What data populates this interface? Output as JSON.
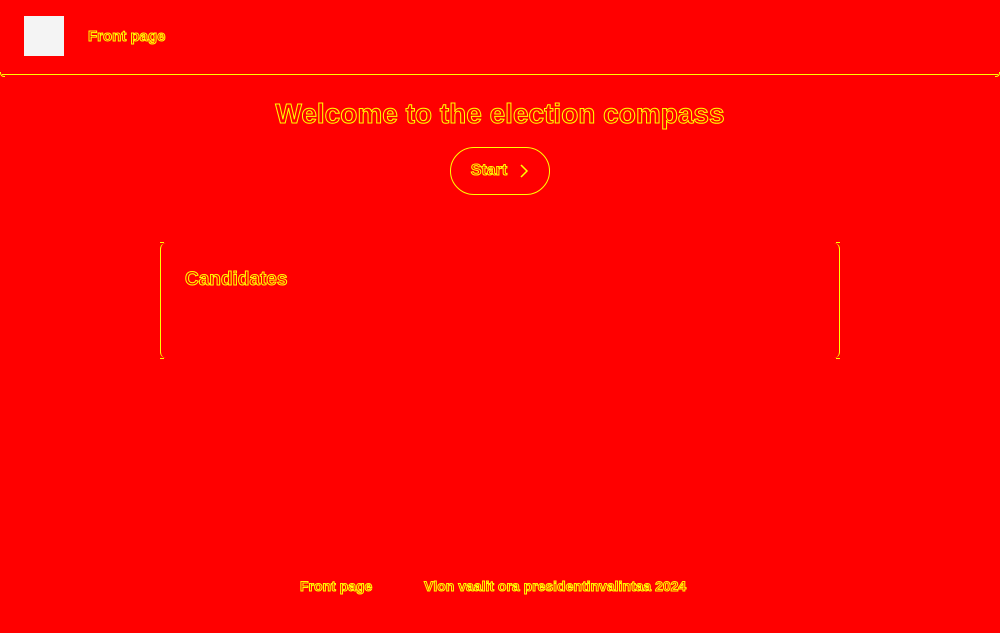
{
  "header": {
    "logo": "app-logo",
    "nav_label": "Front page"
  },
  "hero": {
    "title": "Welcome to the election compass",
    "start_label": "Start",
    "start_icon": "chevron-right-icon"
  },
  "candidates_card": {
    "title": "Candidates"
  },
  "footer": {
    "front_page_label": "Front page",
    "election_label": "Vlon vaalit ora presidentinvalintaa 2024"
  },
  "colors": {
    "background": "#ff0000",
    "outline": "#ffff00",
    "logo": "#f4f4f4"
  }
}
